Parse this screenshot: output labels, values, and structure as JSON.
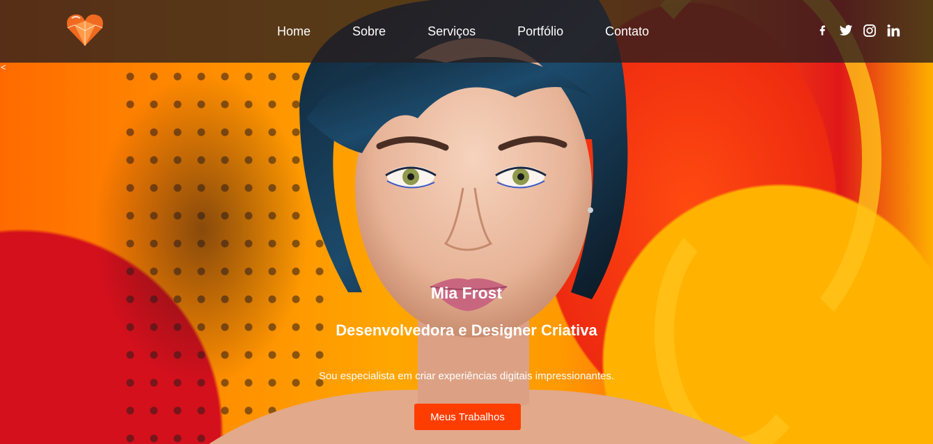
{
  "nav": {
    "logo_icon": "heart-gem-icon",
    "links": [
      "Home",
      "Sobre",
      "Serviços",
      "Portfólio",
      "Contato"
    ]
  },
  "social": [
    "facebook-icon",
    "twitter-icon",
    "instagram-icon",
    "linkedin-icon"
  ],
  "slider": {
    "prev_label": "<"
  },
  "hero": {
    "name": "Mia Frost",
    "role": "Desenvolvedora e Designer Criativa",
    "description": "Sou especialista em criar experiências digitais impressionantes.",
    "cta_label": "Meus Trabalhos"
  },
  "colors": {
    "accent": "#ff3d00",
    "navbar": "#2b1f1f",
    "text": "#ffffff"
  }
}
